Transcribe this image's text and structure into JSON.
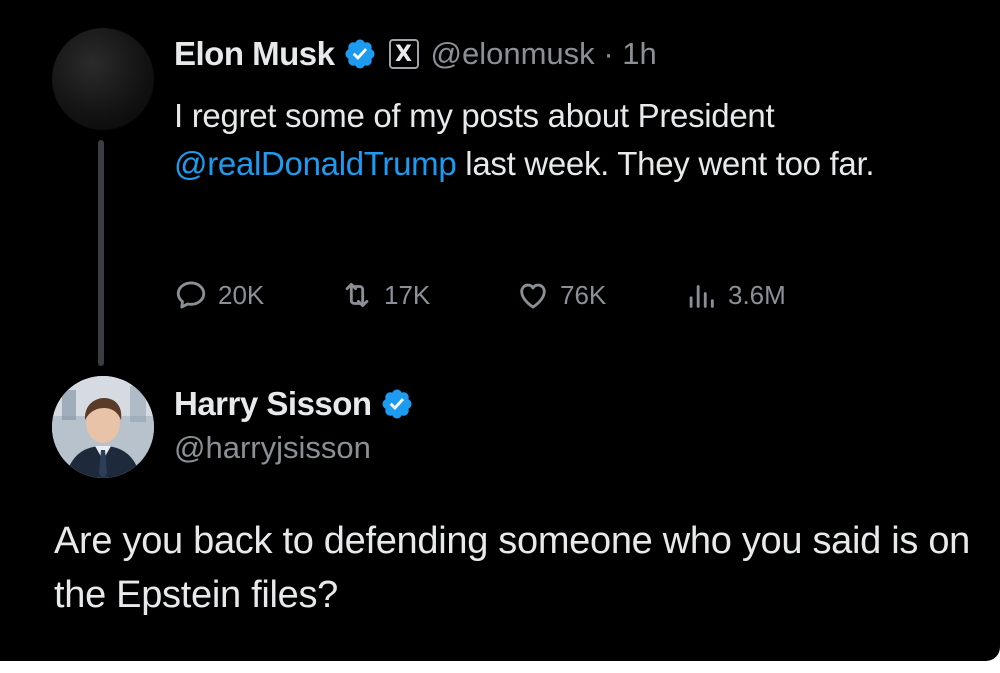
{
  "tweet": {
    "author": {
      "display_name": "Elon Musk",
      "verified": true,
      "affiliate_badge": "X",
      "handle": "@elonmusk",
      "separator": "·",
      "time_ago": "1h"
    },
    "text_before_mention": "I regret some of my posts about President ",
    "mention": "@realDonaldTrump",
    "text_after_mention": " last week. They went too far.",
    "stats": {
      "replies": "20K",
      "reposts": "17K",
      "likes": "76K",
      "views": "3.6M"
    }
  },
  "reply": {
    "author": {
      "display_name": "Harry Sisson",
      "verified": true,
      "handle": "@harryjsisson"
    },
    "text": "Are you back to defending someone who you said is on the Epstein files?"
  },
  "colors": {
    "background": "#000000",
    "text": "#e7e9ea",
    "muted": "#8b9096",
    "link": "#1d9bf0",
    "verified_badge": "#1d9bf0"
  },
  "icons": {
    "reply": "speech-bubble-icon",
    "repost": "repost-arrows-icon",
    "like": "heart-icon",
    "views": "bar-chart-icon",
    "verified": "verified-badge-icon"
  }
}
